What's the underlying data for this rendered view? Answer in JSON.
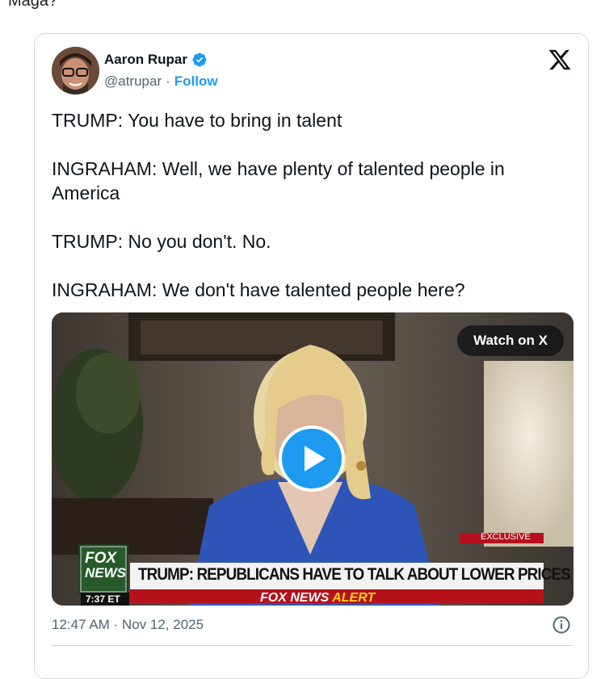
{
  "page": {
    "above_text": "Maga?"
  },
  "tweet": {
    "author_name": "Aaron Rupar",
    "handle": "@atrupar",
    "separator": "·",
    "follow_label": "Follow",
    "lines": [
      "TRUMP: You have to bring in talent",
      "INGRAHAM: Well, we have plenty of talented people in America",
      "TRUMP: No you don't. No.",
      "INGRAHAM: We don't have talented people here?"
    ],
    "timestamp": "12:47 AM · Nov 12, 2025"
  },
  "video": {
    "watch_label": "Watch on X",
    "network_logo_top": "FOX",
    "network_logo_bottom": "NEWS",
    "clock": "7:37 ET",
    "exclusive_tag": "EXCLUSIVE",
    "headline": "TRUMP: REPUBLICANS HAVE TO TALK ABOUT LOWER PRICES",
    "alert_prefix": "FOX NEWS",
    "alert_word": "ALERT"
  },
  "colors": {
    "accent": "#1d9bf0",
    "text": "#0f1419",
    "muted": "#536471",
    "border": "#cfd9de",
    "fox_red": "#b5121b",
    "alert_yellow": "#f7d51d"
  },
  "icons": [
    "verified-badge-icon",
    "x-logo-icon",
    "play-icon",
    "info-icon"
  ]
}
